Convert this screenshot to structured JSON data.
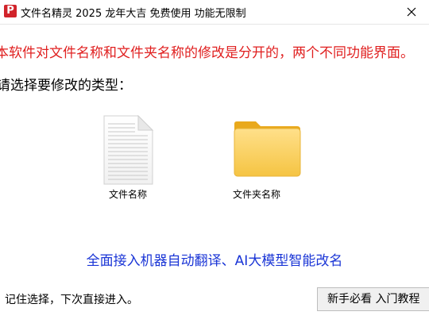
{
  "window": {
    "title": "文件名精灵 2025 龙年大吉 免费使用 功能无限制",
    "app_icon": "pinterest-like-red-icon",
    "close_icon": "close-icon"
  },
  "main": {
    "notice": "本软件对文件名称和文件夹名称的修改是分开的，两个不同功能界面。",
    "prompt": "请选择要修改的类型：",
    "choices": [
      {
        "label": "文件名称",
        "icon": "document-file-icon"
      },
      {
        "label": "文件夹名称",
        "icon": "folder-icon"
      }
    ],
    "feature_text": "全面接入机器自动翻译、AI大模型智能改名"
  },
  "footer": {
    "remember_label": "记住选择，下次直接进入。",
    "tutorial_button": "新手必看 入门教程"
  },
  "colors": {
    "notice": "#e02020",
    "feature": "#1a35d6",
    "folder": "#f7c948",
    "app_icon": "#d1232a"
  }
}
